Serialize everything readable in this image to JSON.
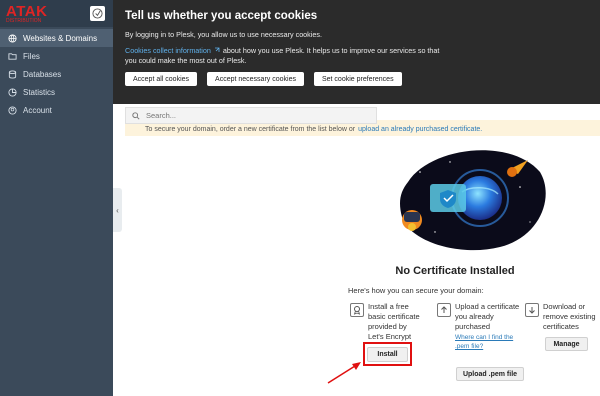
{
  "logo": {
    "text": "ATAK",
    "sub": "DISTRIBUTION"
  },
  "sidebar": {
    "items": [
      {
        "label": "Websites & Domains",
        "icon": "globe-icon",
        "active": true
      },
      {
        "label": "Files",
        "icon": "folder-icon"
      },
      {
        "label": "Databases",
        "icon": "database-icon"
      },
      {
        "label": "Statistics",
        "icon": "chart-icon"
      },
      {
        "label": "Account",
        "icon": "user-icon"
      }
    ],
    "collapse_glyph": "‹"
  },
  "cookie": {
    "title": "Tell us whether you accept cookies",
    "line1": "By logging in to Plesk, you allow us to use necessary cookies.",
    "link": "Cookies collect information",
    "line2": " about how you use Plesk. It helps us to improve our services so that",
    "line3": "you could make the most out of Plesk.",
    "accept_all": "Accept all cookies",
    "accept_necessary": "Accept necessary cookies",
    "set_prefs": "Set cookie preferences"
  },
  "search": {
    "placeholder": "Search..."
  },
  "info": {
    "text": "To secure your domain, order a new certificate from the list below or",
    "link": "upload an already purchased certificate."
  },
  "main": {
    "heading": "No Certificate Installed",
    "sub": "Here's how you can secure your domain:",
    "options": [
      {
        "text": "Install a free basic certificate provided by Let's Encrypt",
        "button": "Install",
        "icon": "certificate-icon"
      },
      {
        "text": "Upload a certificate you already purchased",
        "link": "Where can I find the .pem file?",
        "button": "Upload .pem file",
        "icon": "upload-icon"
      },
      {
        "text": "Download or remove existing certificates",
        "button": "Manage",
        "icon": "download-icon"
      }
    ]
  },
  "colors": {
    "sidebar": "#3b4a5a",
    "banner": "#2b2b2b",
    "accent": "#2a7ab8",
    "highlight": "#e01010"
  }
}
